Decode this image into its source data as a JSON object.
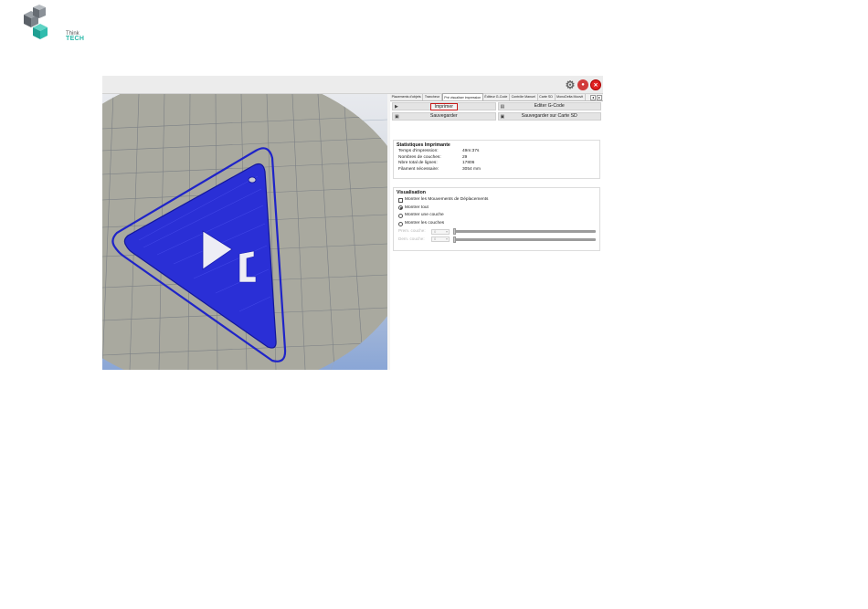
{
  "logo": {
    "brand_small": "Think",
    "brand_tech": "TECH"
  },
  "tabs": [
    {
      "label": "Placements d'objets",
      "active": false
    },
    {
      "label": "Trancheur",
      "active": false
    },
    {
      "label": "Pré visualiser impression",
      "active": true
    },
    {
      "label": "Éditeur G-Code",
      "active": false
    },
    {
      "label": "Contrôle Manuel",
      "active": false
    },
    {
      "label": "Carte SD",
      "active": false
    },
    {
      "label": "MonoDelta Moovit",
      "active": false
    }
  ],
  "tab_nav": {
    "prev": "◂",
    "next": "▸"
  },
  "buttons": {
    "print": "Imprimer",
    "edit_gcode": "Editer G-Code",
    "save": "Sauvegarder",
    "save_sd": "Sauvegarder sur Carte SD"
  },
  "stats": {
    "title": "Statistiques Imprimante",
    "rows": [
      {
        "key": "Temps d'impression:",
        "value": "49m:37s"
      },
      {
        "key": "Nombres de couches:",
        "value": "29"
      },
      {
        "key": "Nbre total de lignes:",
        "value": "17806"
      },
      {
        "key": "Filament nécessaire:",
        "value": "3054 mm"
      }
    ]
  },
  "visual": {
    "title": "Visualisation",
    "show_moves": "Montrer les Mouvements de Déplacements",
    "show_all": "Montrer tout",
    "show_one_layer": "Montrer une couche",
    "show_layers": "Montrer les couches",
    "first_layer_label": "Prem. couche:",
    "last_layer_label": "Dern. couche:",
    "first_layer_value": "0",
    "last_layer_value": "0"
  },
  "colors": {
    "print_blue": "#2a2fd6",
    "bed_gray": "#a8a8a0",
    "stop_red": "#d13a3a",
    "highlight_red": "#c81818"
  }
}
